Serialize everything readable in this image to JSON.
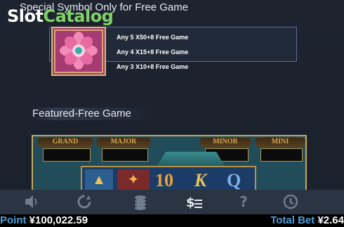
{
  "watermark": {
    "part1": "Slot",
    "part2": "Catalog"
  },
  "special": {
    "title": "Special Symbol Only for Free Game",
    "paylines": [
      "Any 5  X50+8 Free Game",
      "Any 4  X15+8 Free Game",
      "Any 3  X10+8 Free Game"
    ]
  },
  "featured": {
    "title": "Featured-Free Game",
    "jackpots": [
      "GRAND",
      "MAJOR",
      "MINOR",
      "MINI"
    ],
    "symbols": [
      "10",
      "K",
      "Q"
    ]
  },
  "toolbar": {
    "icons": [
      "speaker-icon",
      "autoplay-icon",
      "coins-icon",
      "paytable-icon",
      "help-icon",
      "history-icon"
    ],
    "help_glyph": "?"
  },
  "status": {
    "point_label": "Point",
    "point_value": "¥100,022.59",
    "bet_label": "Total Bet",
    "bet_value": "¥2.64"
  },
  "colors": {
    "background": "#1c2330",
    "label_blue": "#4f9fd8",
    "gold": "#c9a85b",
    "symbol_pink": "#a63a72"
  }
}
